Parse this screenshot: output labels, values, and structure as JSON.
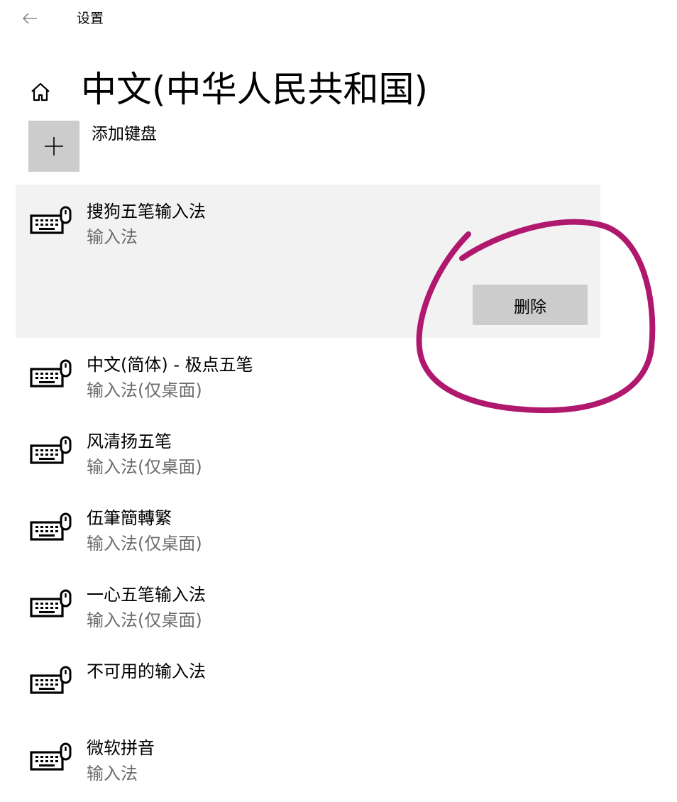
{
  "window": {
    "back_icon": "back-arrow-icon",
    "title": "设置"
  },
  "page": {
    "home_icon": "home-icon",
    "title": "中文(中华人民共和国)"
  },
  "add_keyboard": {
    "icon": "plus-icon",
    "label": "添加键盘"
  },
  "ime_list": [
    {
      "name": "搜狗五笔输入法",
      "type": "输入法",
      "selected": true,
      "remove_label": "删除"
    },
    {
      "name": "中文(简体) - 极点五笔",
      "type": "输入法(仅桌面)"
    },
    {
      "name": "风清扬五笔",
      "type": "输入法(仅桌面)"
    },
    {
      "name": "伍筆簡轉繁",
      "type": "输入法(仅桌面)"
    },
    {
      "name": "一心五笔输入法",
      "type": "输入法(仅桌面)"
    },
    {
      "name": "不可用的输入法",
      "type": ""
    },
    {
      "name": "微软拼音",
      "type": "输入法"
    }
  ],
  "colors": {
    "selected_row_bg": "#f2f2f2",
    "button_bg": "#cccccc",
    "secondary_text": "#6b6b6b",
    "annotation_ink": "#b0186e"
  },
  "item_icon": "keyboard-icon"
}
